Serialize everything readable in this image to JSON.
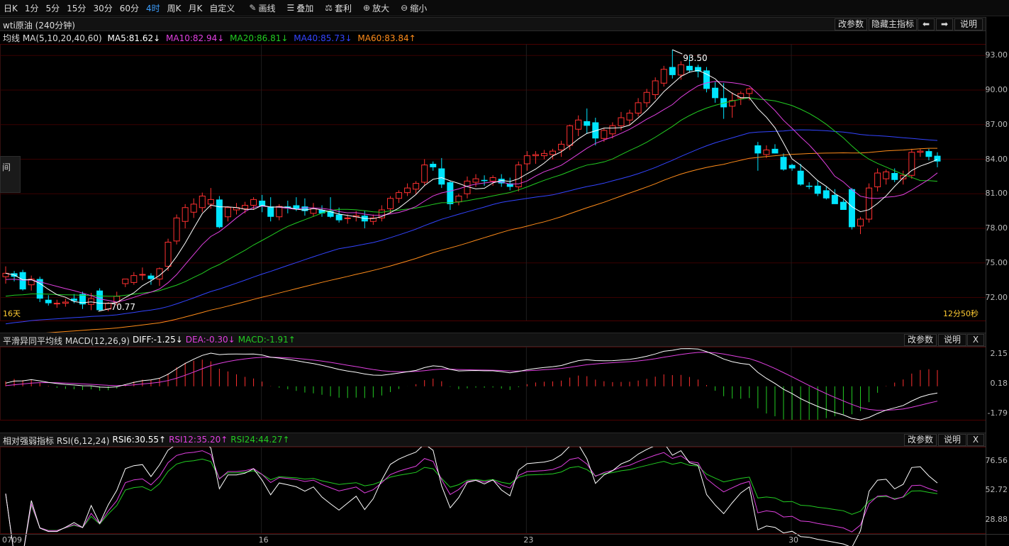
{
  "toolbar": {
    "items": [
      {
        "label": "日K"
      },
      {
        "label": "1分"
      },
      {
        "label": "5分"
      },
      {
        "label": "15分"
      },
      {
        "label": "30分"
      },
      {
        "label": "60分"
      },
      {
        "label": "4时",
        "active": true
      },
      {
        "label": "周K"
      },
      {
        "label": "月K"
      },
      {
        "label": "自定义"
      }
    ],
    "tools": [
      {
        "label": "画线",
        "icon": "pencil-icon"
      },
      {
        "label": "叠加",
        "icon": "stack-icon"
      },
      {
        "label": "套利",
        "icon": "arbitrage-icon"
      },
      {
        "label": "放大",
        "icon": "zoom-in-icon"
      },
      {
        "label": "缩小",
        "icon": "zoom-out-icon"
      }
    ]
  },
  "main": {
    "title": "wti原油 (240分钟)",
    "buttons": {
      "change_params": "改参数",
      "hide_main": "隐藏主指标",
      "prev": "⬅",
      "next": "➡",
      "help": "说明"
    },
    "legend": {
      "name": "均线 MA(5,10,20,40,60)",
      "ma5": "MA5:81.62↓",
      "ma10": "MA10:82.94↓",
      "ma20": "MA20:86.81↓",
      "ma40": "MA40:85.73↓",
      "ma60": "MA60:83.84↑"
    },
    "high_label": "93.50",
    "low_label": "70.77",
    "bottom_left": "16天",
    "bottom_right": "12分50秒",
    "side_tab": "间",
    "y_ticks": [
      "93.00",
      "90.00",
      "87.00",
      "84.00",
      "81.00",
      "78.00",
      "75.00",
      "72.00"
    ]
  },
  "macd": {
    "legend": {
      "name": "平滑异同平均线 MACD(12,26,9)",
      "diff": "DIFF:-1.25↓",
      "dea": "DEA:-0.30↓",
      "macd": "MACD:-1.91↑"
    },
    "buttons": {
      "change_params": "改参数",
      "help": "说明",
      "close": "X"
    },
    "y_ticks": [
      "2.15",
      "0.18",
      "-1.79"
    ]
  },
  "rsi": {
    "legend": {
      "name": "相对强弱指标 RSI(6,12,24)",
      "rsi6": "RSI6:30.55↑",
      "rsi12": "RSI12:35.20↑",
      "rsi24": "RSI24:44.27↑"
    },
    "buttons": {
      "change_params": "改参数",
      "help": "说明",
      "close": "X"
    },
    "y_ticks": [
      "76.56",
      "52.72",
      "28.88"
    ]
  },
  "x_dates": [
    "0709",
    "16",
    "23",
    "30"
  ],
  "colors": {
    "up": "#ff3030",
    "down": "#00e5ff",
    "ma5": "#ffffff",
    "ma10": "#e040e0",
    "ma20": "#22cc22",
    "ma40": "#3344ff",
    "ma60": "#ff8c1a",
    "grid": "#3a0000"
  },
  "chart_data": {
    "type": "candlestick",
    "title": "wti原油 (240分钟)",
    "ylim": [
      70,
      94
    ],
    "ohlc": [
      {
        "o": 73.8,
        "h": 74.7,
        "l": 73.2,
        "c": 74.1
      },
      {
        "o": 74.1,
        "h": 74.3,
        "l": 73.4,
        "c": 73.8
      },
      {
        "o": 74.2,
        "h": 74.4,
        "l": 72.6,
        "c": 72.7
      },
      {
        "o": 73.1,
        "h": 73.9,
        "l": 72.6,
        "c": 73.6
      },
      {
        "o": 73.6,
        "h": 73.8,
        "l": 71.6,
        "c": 71.9
      },
      {
        "o": 71.8,
        "h": 72.2,
        "l": 71.3,
        "c": 71.5
      },
      {
        "o": 71.5,
        "h": 71.8,
        "l": 71.1,
        "c": 71.5
      },
      {
        "o": 71.5,
        "h": 71.9,
        "l": 71.2,
        "c": 71.6
      },
      {
        "o": 71.9,
        "h": 72.3,
        "l": 71.5,
        "c": 71.7
      },
      {
        "o": 72.3,
        "h": 72.5,
        "l": 71.0,
        "c": 71.4
      },
      {
        "o": 71.4,
        "h": 72.4,
        "l": 70.9,
        "c": 71.9
      },
      {
        "o": 72.6,
        "h": 72.8,
        "l": 70.8,
        "c": 70.9
      },
      {
        "o": 71.0,
        "h": 71.6,
        "l": 70.8,
        "c": 71.5
      },
      {
        "o": 71.6,
        "h": 72.5,
        "l": 71.3,
        "c": 72.1
      },
      {
        "o": 73.2,
        "h": 73.6,
        "l": 72.9,
        "c": 73.6
      },
      {
        "o": 73.3,
        "h": 74.2,
        "l": 73.1,
        "c": 73.9
      },
      {
        "o": 74.0,
        "h": 74.6,
        "l": 73.5,
        "c": 74.0
      },
      {
        "o": 73.9,
        "h": 74.1,
        "l": 73.1,
        "c": 73.6
      },
      {
        "o": 73.6,
        "h": 74.6,
        "l": 73.0,
        "c": 74.5
      },
      {
        "o": 74.7,
        "h": 77.1,
        "l": 74.3,
        "c": 76.8
      },
      {
        "o": 76.9,
        "h": 79.2,
        "l": 76.6,
        "c": 78.9
      },
      {
        "o": 78.6,
        "h": 80.1,
        "l": 78.0,
        "c": 79.8
      },
      {
        "o": 79.4,
        "h": 80.6,
        "l": 78.9,
        "c": 80.1
      },
      {
        "o": 79.8,
        "h": 81.1,
        "l": 79.4,
        "c": 80.8
      },
      {
        "o": 80.1,
        "h": 81.5,
        "l": 79.7,
        "c": 80.5
      },
      {
        "o": 80.5,
        "h": 80.8,
        "l": 78.0,
        "c": 78.1
      },
      {
        "o": 79.0,
        "h": 79.9,
        "l": 78.6,
        "c": 79.8
      },
      {
        "o": 79.6,
        "h": 80.2,
        "l": 79.2,
        "c": 79.8
      },
      {
        "o": 79.7,
        "h": 80.3,
        "l": 79.3,
        "c": 80.0
      },
      {
        "o": 80.0,
        "h": 80.7,
        "l": 79.6,
        "c": 80.5
      },
      {
        "o": 80.4,
        "h": 80.9,
        "l": 79.4,
        "c": 79.9
      },
      {
        "o": 79.9,
        "h": 80.7,
        "l": 78.6,
        "c": 79.0
      },
      {
        "o": 79.0,
        "h": 80.1,
        "l": 78.7,
        "c": 79.9
      },
      {
        "o": 79.9,
        "h": 80.4,
        "l": 79.3,
        "c": 79.8
      },
      {
        "o": 80.0,
        "h": 80.7,
        "l": 79.5,
        "c": 79.7
      },
      {
        "o": 79.9,
        "h": 80.6,
        "l": 79.1,
        "c": 79.5
      },
      {
        "o": 79.3,
        "h": 80.2,
        "l": 79.0,
        "c": 79.7
      },
      {
        "o": 79.6,
        "h": 80.0,
        "l": 79.0,
        "c": 79.3
      },
      {
        "o": 79.5,
        "h": 80.7,
        "l": 78.9,
        "c": 79.0
      },
      {
        "o": 79.2,
        "h": 79.8,
        "l": 78.5,
        "c": 78.7
      },
      {
        "o": 78.9,
        "h": 79.2,
        "l": 78.4,
        "c": 78.9
      },
      {
        "o": 79.0,
        "h": 79.5,
        "l": 78.6,
        "c": 79.1
      },
      {
        "o": 79.1,
        "h": 79.5,
        "l": 78.0,
        "c": 78.6
      },
      {
        "o": 78.6,
        "h": 79.2,
        "l": 78.3,
        "c": 78.9
      },
      {
        "o": 78.9,
        "h": 80.0,
        "l": 78.6,
        "c": 79.6
      },
      {
        "o": 79.7,
        "h": 80.8,
        "l": 79.3,
        "c": 80.6
      },
      {
        "o": 80.6,
        "h": 81.3,
        "l": 80.2,
        "c": 81.1
      },
      {
        "o": 81.1,
        "h": 81.9,
        "l": 80.8,
        "c": 81.5
      },
      {
        "o": 81.4,
        "h": 82.1,
        "l": 81.0,
        "c": 81.9
      },
      {
        "o": 82.0,
        "h": 84.0,
        "l": 81.7,
        "c": 83.5
      },
      {
        "o": 83.6,
        "h": 83.8,
        "l": 83.0,
        "c": 83.3
      },
      {
        "o": 83.2,
        "h": 84.1,
        "l": 81.5,
        "c": 81.8
      },
      {
        "o": 82.0,
        "h": 82.1,
        "l": 79.6,
        "c": 80.1
      },
      {
        "o": 80.3,
        "h": 81.0,
        "l": 80.0,
        "c": 80.8
      },
      {
        "o": 81.0,
        "h": 82.5,
        "l": 80.6,
        "c": 82.1
      },
      {
        "o": 82.0,
        "h": 82.7,
        "l": 81.6,
        "c": 82.3
      },
      {
        "o": 82.2,
        "h": 82.6,
        "l": 81.7,
        "c": 82.1
      },
      {
        "o": 82.1,
        "h": 82.6,
        "l": 81.7,
        "c": 82.4
      },
      {
        "o": 82.3,
        "h": 82.7,
        "l": 81.6,
        "c": 81.9
      },
      {
        "o": 81.9,
        "h": 82.4,
        "l": 81.3,
        "c": 81.6
      },
      {
        "o": 81.6,
        "h": 83.8,
        "l": 81.2,
        "c": 83.5
      },
      {
        "o": 83.6,
        "h": 84.7,
        "l": 83.0,
        "c": 84.3
      },
      {
        "o": 84.3,
        "h": 84.7,
        "l": 83.6,
        "c": 84.4
      },
      {
        "o": 84.3,
        "h": 84.8,
        "l": 84.0,
        "c": 84.5
      },
      {
        "o": 84.4,
        "h": 84.9,
        "l": 84.0,
        "c": 84.7
      },
      {
        "o": 84.8,
        "h": 85.6,
        "l": 84.2,
        "c": 85.3
      },
      {
        "o": 85.2,
        "h": 87.0,
        "l": 84.8,
        "c": 86.9
      },
      {
        "o": 86.6,
        "h": 87.8,
        "l": 86.0,
        "c": 87.4
      },
      {
        "o": 87.3,
        "h": 88.4,
        "l": 86.2,
        "c": 86.9
      },
      {
        "o": 87.2,
        "h": 87.6,
        "l": 85.2,
        "c": 85.8
      },
      {
        "o": 85.8,
        "h": 86.7,
        "l": 85.5,
        "c": 86.5
      },
      {
        "o": 86.2,
        "h": 87.2,
        "l": 85.8,
        "c": 86.9
      },
      {
        "o": 86.9,
        "h": 88.1,
        "l": 86.5,
        "c": 87.6
      },
      {
        "o": 87.4,
        "h": 88.3,
        "l": 87.0,
        "c": 88.0
      },
      {
        "o": 88.0,
        "h": 89.3,
        "l": 87.7,
        "c": 88.9
      },
      {
        "o": 88.9,
        "h": 90.1,
        "l": 88.5,
        "c": 89.8
      },
      {
        "o": 89.6,
        "h": 91.1,
        "l": 89.2,
        "c": 90.8
      },
      {
        "o": 90.6,
        "h": 92.1,
        "l": 90.3,
        "c": 91.8
      },
      {
        "o": 92.0,
        "h": 93.5,
        "l": 91.0,
        "c": 91.3
      },
      {
        "o": 91.3,
        "h": 92.5,
        "l": 90.9,
        "c": 92.2
      },
      {
        "o": 92.1,
        "h": 93.0,
        "l": 91.5,
        "c": 91.7
      },
      {
        "o": 92.0,
        "h": 92.2,
        "l": 91.1,
        "c": 91.6
      },
      {
        "o": 91.7,
        "h": 92.0,
        "l": 89.8,
        "c": 90.1
      },
      {
        "o": 90.2,
        "h": 90.7,
        "l": 88.9,
        "c": 89.3
      },
      {
        "o": 89.3,
        "h": 90.6,
        "l": 87.5,
        "c": 88.5
      },
      {
        "o": 88.6,
        "h": 89.8,
        "l": 87.6,
        "c": 89.1
      },
      {
        "o": 89.3,
        "h": 89.9,
        "l": 88.7,
        "c": 89.7
      },
      {
        "o": 89.7,
        "h": 90.2,
        "l": 89.1,
        "c": 90.1
      },
      {
        "o": 85.2,
        "h": 85.5,
        "l": 83.0,
        "c": 84.5
      },
      {
        "o": 84.4,
        "h": 85.2,
        "l": 84.1,
        "c": 84.8
      },
      {
        "o": 84.9,
        "h": 85.3,
        "l": 84.5,
        "c": 84.5
      },
      {
        "o": 84.2,
        "h": 84.5,
        "l": 83.0,
        "c": 83.1
      },
      {
        "o": 83.5,
        "h": 83.6,
        "l": 83.0,
        "c": 83.2
      },
      {
        "o": 83.0,
        "h": 83.6,
        "l": 81.7,
        "c": 81.8
      },
      {
        "o": 81.7,
        "h": 82.0,
        "l": 81.4,
        "c": 81.6
      },
      {
        "o": 81.7,
        "h": 82.2,
        "l": 80.8,
        "c": 81.0
      },
      {
        "o": 81.3,
        "h": 81.6,
        "l": 80.5,
        "c": 80.6
      },
      {
        "o": 80.9,
        "h": 81.4,
        "l": 80.3,
        "c": 80.1
      },
      {
        "o": 80.3,
        "h": 80.5,
        "l": 79.6,
        "c": 79.6
      },
      {
        "o": 81.4,
        "h": 81.5,
        "l": 77.9,
        "c": 78.1
      },
      {
        "o": 78.2,
        "h": 79.0,
        "l": 77.5,
        "c": 78.8
      },
      {
        "o": 78.8,
        "h": 81.9,
        "l": 78.5,
        "c": 81.5
      },
      {
        "o": 81.6,
        "h": 83.2,
        "l": 81.2,
        "c": 82.8
      },
      {
        "o": 82.3,
        "h": 83.1,
        "l": 81.8,
        "c": 82.9
      },
      {
        "o": 82.8,
        "h": 83.2,
        "l": 82.0,
        "c": 82.2
      },
      {
        "o": 82.3,
        "h": 83.0,
        "l": 81.8,
        "c": 82.6
      },
      {
        "o": 82.6,
        "h": 84.9,
        "l": 82.3,
        "c": 84.6
      },
      {
        "o": 84.6,
        "h": 84.9,
        "l": 84.2,
        "c": 84.7
      },
      {
        "o": 84.7,
        "h": 84.9,
        "l": 83.9,
        "c": 84.2
      },
      {
        "o": 84.3,
        "h": 84.6,
        "l": 83.3,
        "c": 83.8
      }
    ]
  }
}
